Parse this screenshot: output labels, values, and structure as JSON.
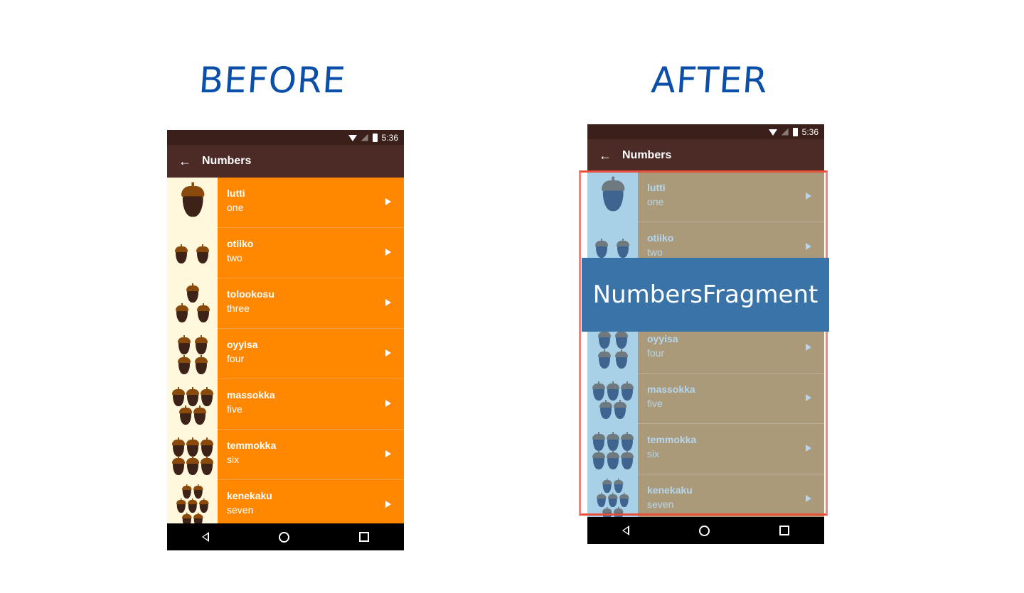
{
  "headings": {
    "before": "BEFORE",
    "after": "AFTER"
  },
  "status": {
    "time": "5:36"
  },
  "appbar": {
    "title": "Numbers"
  },
  "rows": [
    {
      "word": "lutti",
      "translation": "one",
      "count": 1
    },
    {
      "word": "otiiko",
      "translation": "two",
      "count": 2
    },
    {
      "word": "tolookosu",
      "translation": "three",
      "count": 3
    },
    {
      "word": "oyyisa",
      "translation": "four",
      "count": 4
    },
    {
      "word": "massokka",
      "translation": "five",
      "count": 5
    },
    {
      "word": "temmokka",
      "translation": "six",
      "count": 6
    },
    {
      "word": "kenekaku",
      "translation": "seven",
      "count": 7
    }
  ],
  "fragment": {
    "label": "NumbersFragment"
  },
  "colors": {
    "before_list": "#ff8800",
    "after_list": "#aa9a7a",
    "fragment_label": "#3a73a8",
    "fragment_border": "#ee8484",
    "appbar": "#4c2b26"
  }
}
